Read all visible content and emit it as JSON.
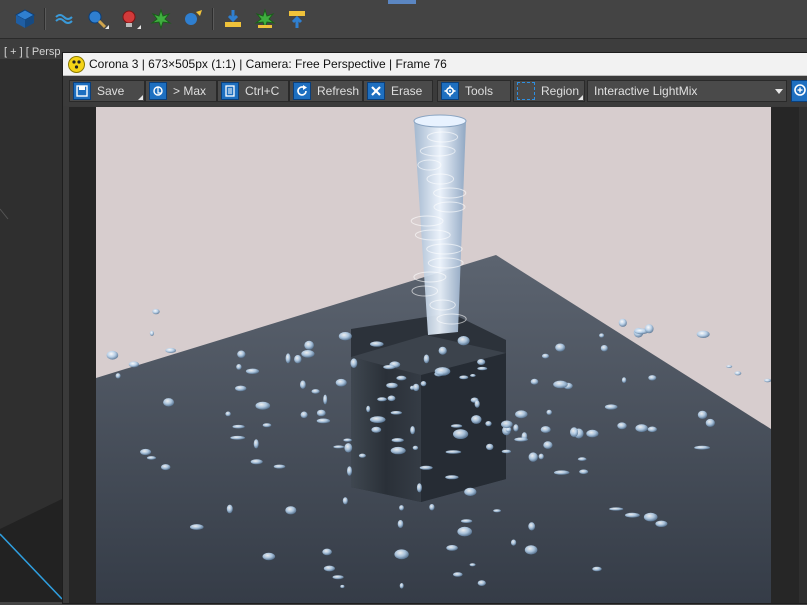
{
  "app": {
    "toolbar_icons": [
      "layers-icon",
      "wave-icon",
      "paint-brush-icon",
      "light-bulb-icon",
      "render-setup-icon",
      "render-active-icon",
      "render-download-icon",
      "render-lights-icon",
      "render-upload-icon"
    ]
  },
  "viewport": {
    "label": "[ + ] [ Persp"
  },
  "vfb": {
    "title": "Corona 3 | 673×505px (1:1) | Camera: Free Perspective | Frame 76",
    "toolbar": {
      "save": "Save",
      "to_max": "> Max",
      "copy": "Ctrl+C",
      "refresh": "Refresh",
      "erase": "Erase",
      "tools": "Tools",
      "region": "Region"
    },
    "lightmix_select": "Interactive LightMix",
    "colors": {
      "accent": "#1e6fc0",
      "logo": "#f4d316",
      "background": "#d7cdce",
      "floor": "#434b56"
    }
  }
}
